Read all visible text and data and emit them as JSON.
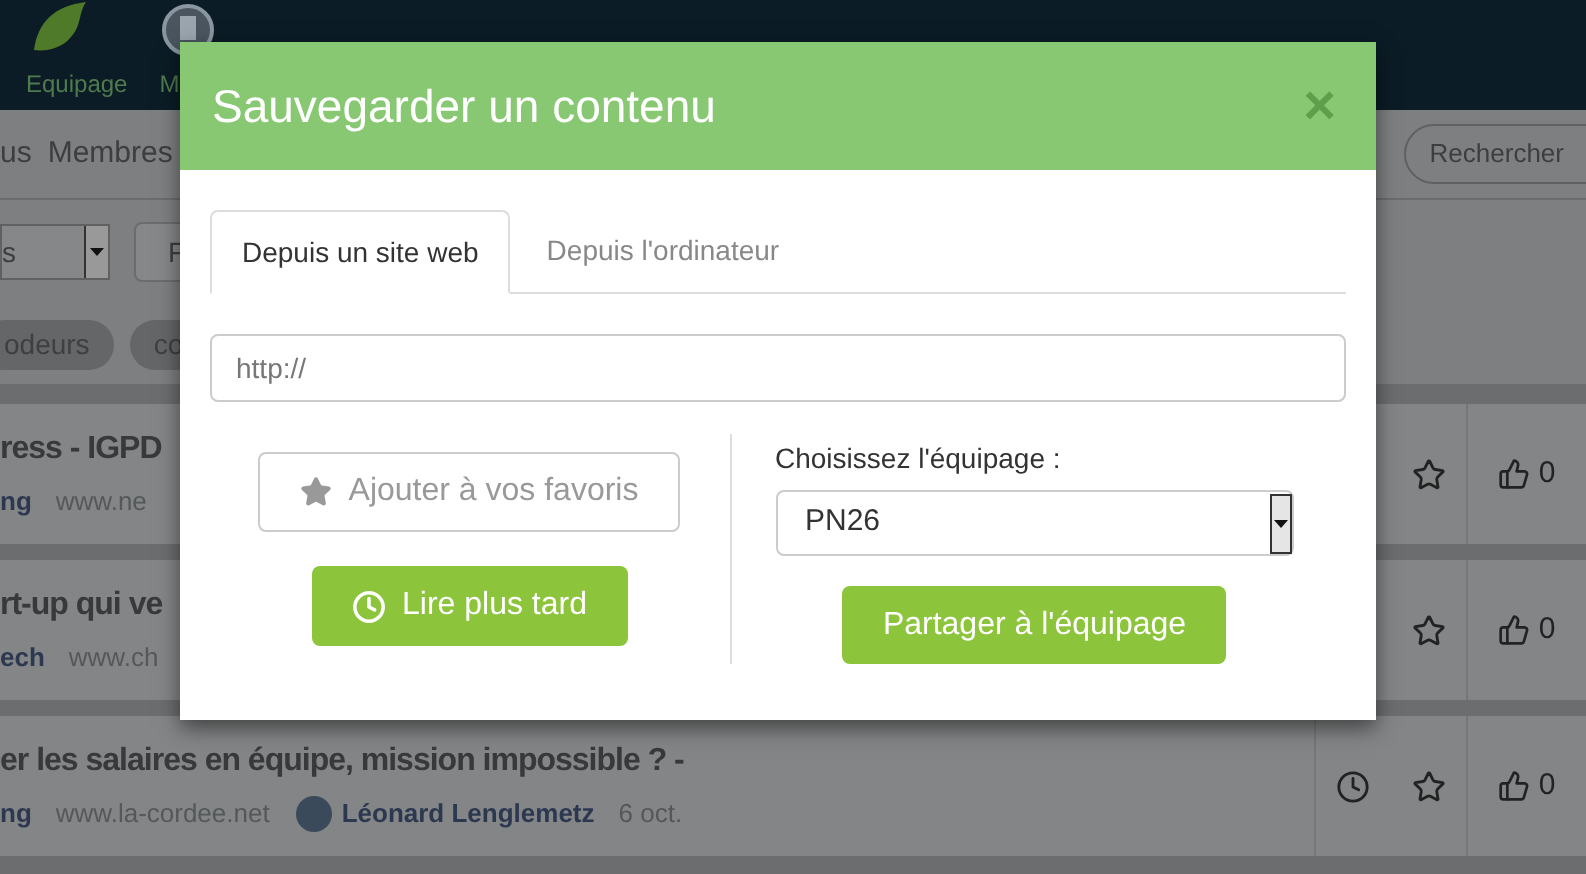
{
  "nav": {
    "items": [
      {
        "label": "Equipage"
      },
      {
        "label": "M"
      }
    ]
  },
  "subnav": {
    "items": [
      {
        "label": "us"
      },
      {
        "label": "Membres"
      }
    ],
    "search_button": "Rechercher"
  },
  "filters": {
    "select_value": "s",
    "field_value": "F"
  },
  "tags": [
    "odeurs",
    "co"
  ],
  "articles": [
    {
      "title": "ress - IGPD",
      "tag": "ng",
      "site": "www.ne",
      "clock": false,
      "likes": "0"
    },
    {
      "title": "rt-up qui ve",
      "tag": "ech",
      "site": "www.ch",
      "clock": false,
      "likes": "0"
    },
    {
      "title": "er les salaires en équipe, mission impossible ? -",
      "tag": "ng",
      "site": "www.la-cordee.net",
      "author": "Léonard Lenglemetz",
      "date": "6 oct.",
      "clock": true,
      "likes": "0"
    }
  ],
  "modal": {
    "title": "Sauvegarder un contenu",
    "close": "×",
    "tabs": [
      {
        "label": "Depuis un site web",
        "selected": true
      },
      {
        "label": "Depuis l'ordinateur",
        "selected": false
      }
    ],
    "url_placeholder": "http://",
    "favorite_button": "Ajouter à vos favoris",
    "read_later_button": "Lire plus tard",
    "team_label": "Choisissez l'équipage :",
    "team_value": "PN26",
    "share_button": "Partager à l'équipage"
  }
}
